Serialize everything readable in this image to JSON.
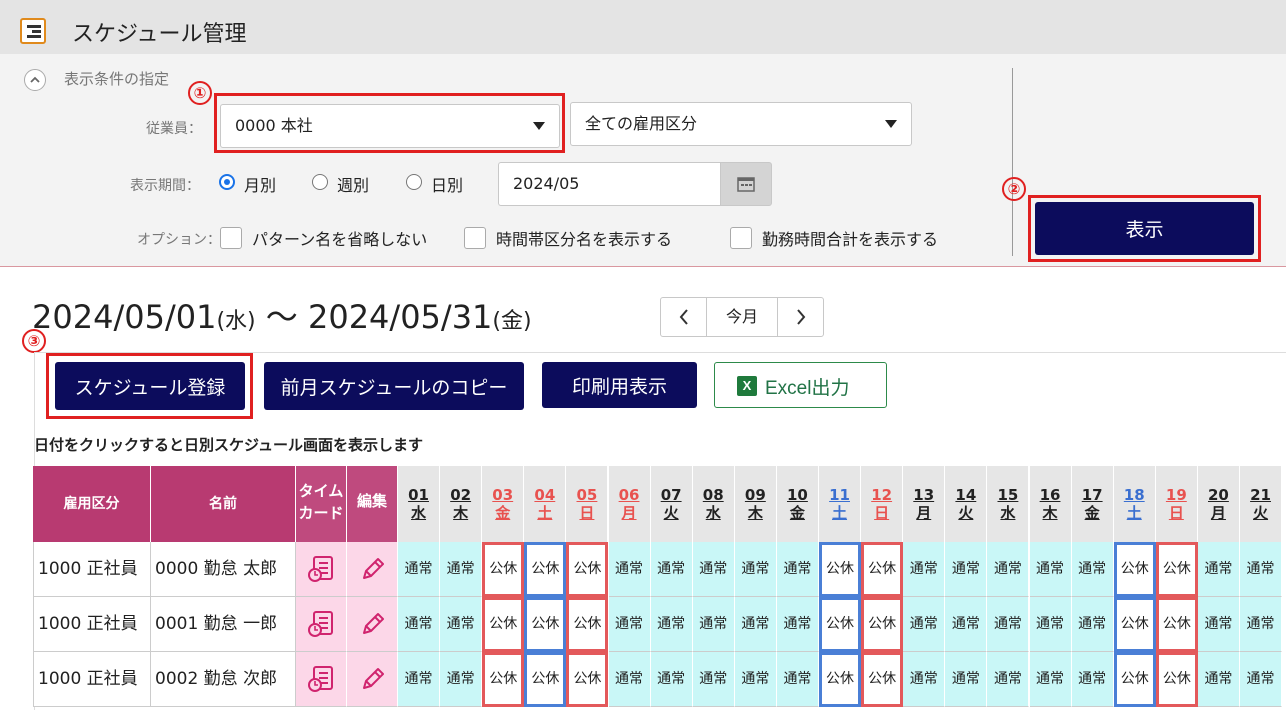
{
  "app": {
    "title": "スケジュール管理"
  },
  "conditions": {
    "header": "表示条件の指定",
    "employee_label": "従業員：",
    "employee_value": "0000 本社",
    "employment_value": "全ての雇用区分",
    "period_label": "表示期間：",
    "period_options": [
      {
        "label": "月別",
        "selected": true
      },
      {
        "label": "週別",
        "selected": false
      },
      {
        "label": "日別",
        "selected": false
      }
    ],
    "date_value": "2024/05",
    "options_label": "オプション：",
    "checkboxes": [
      {
        "label": "パターン名を省略しない",
        "checked": false
      },
      {
        "label": "時間帯区分名を表示する",
        "checked": false
      },
      {
        "label": "勤務時間合計を表示する",
        "checked": false
      }
    ],
    "show_button": "表示"
  },
  "markers": [
    "①",
    "②",
    "③"
  ],
  "range": {
    "start": "2024/05/01",
    "start_dow": "(水)",
    "separator": "〜",
    "end": "2024/05/31",
    "end_dow": "(金)"
  },
  "nav": {
    "prev": "<",
    "current": "今月",
    "next": ">"
  },
  "toolbar": {
    "register": "スケジュール登録",
    "copy_prev": "前月スケジュールのコピー",
    "print_view": "印刷用表示",
    "excel_icon": "X",
    "excel": "Excel出力"
  },
  "hint": "日付をクリックすると日別スケジュール画面を表示します",
  "table": {
    "headers": {
      "type": "雇用区分",
      "name": "名前",
      "timecard_1": "タイム",
      "timecard_2": "カード",
      "edit": "編集"
    },
    "days": [
      {
        "d": "01",
        "w": "水",
        "kind": "weekday"
      },
      {
        "d": "02",
        "w": "木",
        "kind": "weekday"
      },
      {
        "d": "03",
        "w": "金",
        "kind": "holiday"
      },
      {
        "d": "04",
        "w": "土",
        "kind": "holiday"
      },
      {
        "d": "05",
        "w": "日",
        "kind": "holiday"
      },
      {
        "d": "06",
        "w": "月",
        "kind": "holiday"
      },
      {
        "d": "07",
        "w": "火",
        "kind": "weekday"
      },
      {
        "d": "08",
        "w": "水",
        "kind": "weekday"
      },
      {
        "d": "09",
        "w": "木",
        "kind": "weekday"
      },
      {
        "d": "10",
        "w": "金",
        "kind": "weekday"
      },
      {
        "d": "11",
        "w": "土",
        "kind": "saturday"
      },
      {
        "d": "12",
        "w": "日",
        "kind": "holiday"
      },
      {
        "d": "13",
        "w": "月",
        "kind": "weekday"
      },
      {
        "d": "14",
        "w": "火",
        "kind": "weekday"
      },
      {
        "d": "15",
        "w": "水",
        "kind": "weekday"
      },
      {
        "d": "16",
        "w": "木",
        "kind": "weekday"
      },
      {
        "d": "17",
        "w": "金",
        "kind": "weekday"
      },
      {
        "d": "18",
        "w": "土",
        "kind": "saturday"
      },
      {
        "d": "19",
        "w": "日",
        "kind": "holiday"
      },
      {
        "d": "20",
        "w": "月",
        "kind": "weekday"
      },
      {
        "d": "21",
        "w": "火",
        "kind": "weekday"
      }
    ],
    "day_colors": {
      "weekday": "#222222",
      "holiday": "#e8524f",
      "saturday": "#3a6fd0"
    },
    "work_label": "通常",
    "off_label": "公休",
    "off_marks": {
      "03": "red",
      "04": "blue",
      "05": "red",
      "11": "blue",
      "12": "red",
      "18": "blue",
      "19": "red"
    },
    "rows": [
      {
        "type": "1000 正社員",
        "name": "0000 勤怠 太郎"
      },
      {
        "type": "1000 正社員",
        "name": "0001 勤怠 一郎"
      },
      {
        "type": "1000 正社員",
        "name": "0002 勤怠 次郎"
      }
    ]
  }
}
